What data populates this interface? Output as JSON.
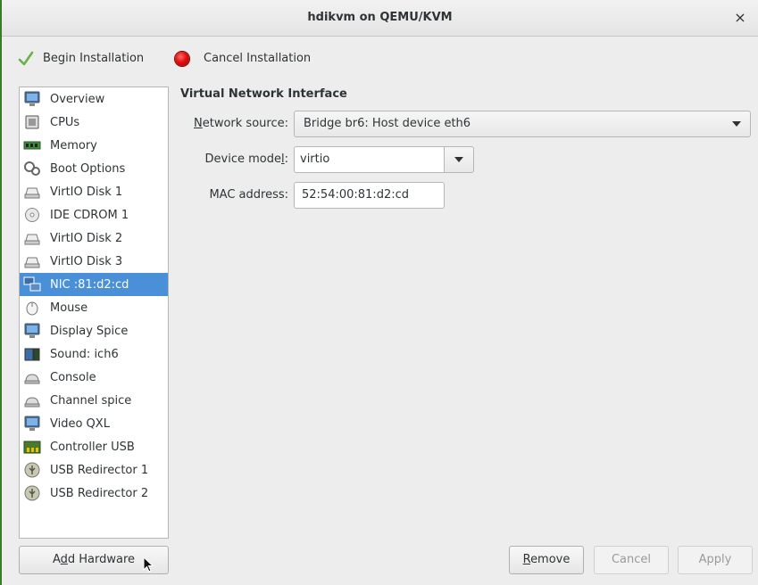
{
  "window": {
    "title": "hdikvm on QEMU/KVM",
    "close_glyph": "×"
  },
  "toolbar": {
    "begin_label": "Begin Installation",
    "begin_icon": "checkmark-icon",
    "cancel_label": "Cancel Installation",
    "cancel_icon": "stop-icon"
  },
  "sidebar": {
    "items": [
      {
        "label": "Overview",
        "icon": "monitor-icon"
      },
      {
        "label": "CPUs",
        "icon": "cpu-icon"
      },
      {
        "label": "Memory",
        "icon": "memory-icon"
      },
      {
        "label": "Boot Options",
        "icon": "gears-icon"
      },
      {
        "label": "VirtIO Disk 1",
        "icon": "disk-icon"
      },
      {
        "label": "IDE CDROM 1",
        "icon": "cdrom-icon"
      },
      {
        "label": "VirtIO Disk 2",
        "icon": "disk-icon"
      },
      {
        "label": "VirtIO Disk 3",
        "icon": "disk-icon"
      },
      {
        "label": "NIC :81:d2:cd",
        "icon": "network-icon",
        "selected": true
      },
      {
        "label": "Mouse",
        "icon": "mouse-icon"
      },
      {
        "label": "Display Spice",
        "icon": "monitor-icon"
      },
      {
        "label": "Sound: ich6",
        "icon": "sound-icon"
      },
      {
        "label": "Console",
        "icon": "serial-icon"
      },
      {
        "label": "Channel spice",
        "icon": "serial-icon"
      },
      {
        "label": "Video QXL",
        "icon": "monitor-icon"
      },
      {
        "label": "Controller USB",
        "icon": "controller-icon"
      },
      {
        "label": "USB Redirector 1",
        "icon": "usb-icon"
      },
      {
        "label": "USB Redirector 2",
        "icon": "usb-icon"
      }
    ],
    "add_hardware_pre": "A",
    "add_hardware_mn": "d",
    "add_hardware_post": "d Hardware"
  },
  "details": {
    "section_title": "Virtual Network Interface",
    "network_source_mn": "N",
    "network_source_rest": "etwork source:",
    "network_source_value": "Bridge br6: Host device eth6",
    "device_model_pre": "Device mode",
    "device_model_mn": "l",
    "device_model_post": ":",
    "device_model_value": "virtio",
    "mac_label": "MAC address:",
    "mac_value": "52:54:00:81:d2:cd"
  },
  "actions": {
    "remove_mn": "R",
    "remove_rest": "emove",
    "cancel_label": "Cancel",
    "apply_label": "Apply"
  },
  "colors": {
    "selection": "#4a90d9",
    "stop_red": "#e01010",
    "check_green": "#6ab04c"
  }
}
